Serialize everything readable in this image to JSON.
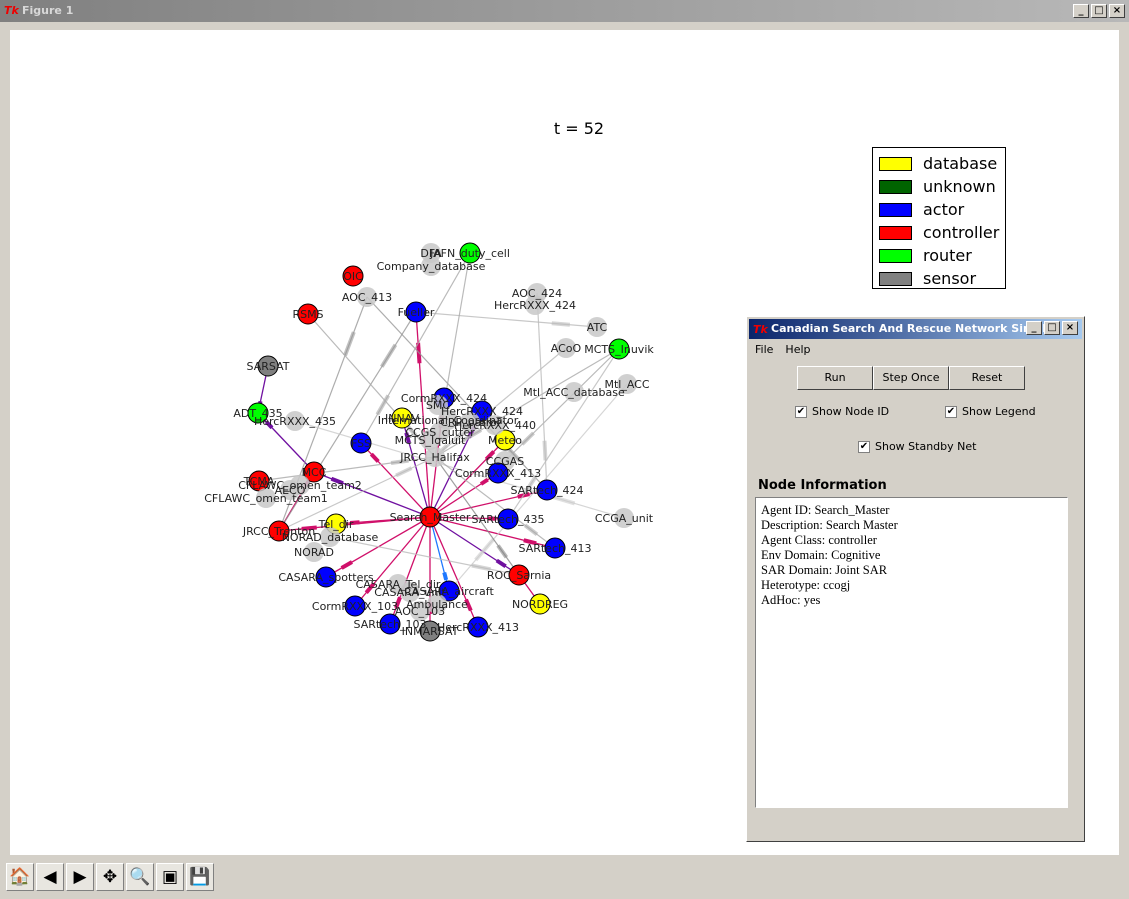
{
  "window": {
    "title": "Figure 1",
    "controls": [
      "_",
      "□",
      "×"
    ]
  },
  "plot": {
    "title": "t = 52",
    "legend": [
      {
        "label": "database",
        "color": "#ffff00"
      },
      {
        "label": "unknown",
        "color": "#006400"
      },
      {
        "label": "actor",
        "color": "#0000ff"
      },
      {
        "label": "controller",
        "color": "#ff0000"
      },
      {
        "label": "router",
        "color": "#00ff00"
      },
      {
        "label": "sensor",
        "color": "#808080"
      }
    ],
    "nodes": [
      {
        "id": "DFA",
        "type": "sensor"
      },
      {
        "id": "JAFN_duty_cell",
        "type": "router"
      },
      {
        "id": "Company_database",
        "type": "sensor"
      },
      {
        "id": "OIC",
        "type": "controller"
      },
      {
        "id": "AOC_413",
        "type": "sensor"
      },
      {
        "id": "RSMS",
        "type": "controller"
      },
      {
        "id": "Fueller",
        "type": "actor"
      },
      {
        "id": "AOC_424",
        "type": "sensor"
      },
      {
        "id": "HercRXXX_424",
        "type": "sensor"
      },
      {
        "id": "ATC",
        "type": "sensor"
      },
      {
        "id": "ACoO",
        "type": "sensor"
      },
      {
        "id": "MCTS_Inuvik",
        "type": "router"
      },
      {
        "id": "Mtl_ACC",
        "type": "sensor"
      },
      {
        "id": "Mtl_ACC_database",
        "type": "sensor"
      },
      {
        "id": "SARSAT",
        "type": "sensor-active"
      },
      {
        "id": "ADT_435",
        "type": "router"
      },
      {
        "id": "HercRXXX_435",
        "type": "sensor"
      },
      {
        "id": "CormRXXX_424",
        "type": "actor"
      },
      {
        "id": "HercRXXX_424",
        "type": "actor"
      },
      {
        "id": "INNAV",
        "type": "database"
      },
      {
        "id": "Meteo",
        "type": "database"
      },
      {
        "id": "FSS",
        "type": "actor"
      },
      {
        "id": "JRCC_Halifax",
        "type": "sensor"
      },
      {
        "id": "CCGAS",
        "type": "sensor"
      },
      {
        "id": "CormRXXX_413",
        "type": "actor"
      },
      {
        "id": "SARtech_424",
        "type": "actor"
      },
      {
        "id": "MCC",
        "type": "controller"
      },
      {
        "id": "TCMA",
        "type": "controller"
      },
      {
        "id": "CFLAWC_omen_team2",
        "type": "sensor"
      },
      {
        "id": "CFLAWC_omen_team1",
        "type": "sensor"
      },
      {
        "id": "AECO",
        "type": "sensor"
      },
      {
        "id": "Search_Master",
        "type": "controller"
      },
      {
        "id": "SARtech_435",
        "type": "actor"
      },
      {
        "id": "CCGA_unit",
        "type": "sensor"
      },
      {
        "id": "JRCC_Trenton",
        "type": "controller"
      },
      {
        "id": "Tel_dir",
        "type": "database"
      },
      {
        "id": "NORAD_database",
        "type": "sensor"
      },
      {
        "id": "NORAD",
        "type": "sensor"
      },
      {
        "id": "SARtech_413",
        "type": "actor"
      },
      {
        "id": "ROC_Sarnia",
        "type": "controller"
      },
      {
        "id": "NORDREG",
        "type": "database"
      },
      {
        "id": "CASARA_spotters",
        "type": "actor"
      },
      {
        "id": "CASARA_Tel_dir",
        "type": "sensor"
      },
      {
        "id": "CASARA_unit",
        "type": "sensor"
      },
      {
        "id": "CASARA_aircraft",
        "type": "actor"
      },
      {
        "id": "Ambulance",
        "type": "sensor"
      },
      {
        "id": "AOC_103",
        "type": "sensor"
      },
      {
        "id": "CormRXXX_103",
        "type": "actor"
      },
      {
        "id": "SARtech_103",
        "type": "actor"
      },
      {
        "id": "INMARSAT",
        "type": "sensor-active"
      },
      {
        "id": "HercRXXX_413",
        "type": "actor"
      },
      {
        "id": "International_Coordinator",
        "type": "sensor"
      },
      {
        "id": "CRP_patrol",
        "type": "sensor"
      },
      {
        "id": "HercRXXX_440",
        "type": "sensor"
      },
      {
        "id": "CCGS_cutter",
        "type": "sensor"
      },
      {
        "id": "SMC",
        "type": "sensor"
      },
      {
        "id": "MCTS_Iqaluit",
        "type": "sensor"
      }
    ],
    "edges": [
      [
        "Search_Master",
        "Fueller",
        "#d0106a"
      ],
      [
        "Search_Master",
        "FSS",
        "#d0106a"
      ],
      [
        "Search_Master",
        "Meteo",
        "#d0106a"
      ],
      [
        "Search_Master",
        "CormRXXX_413",
        "#d0106a"
      ],
      [
        "Search_Master",
        "SARtech_424",
        "#d0106a"
      ],
      [
        "Search_Master",
        "SARtech_435",
        "#d0106a"
      ],
      [
        "Search_Master",
        "SARtech_413",
        "#d0106a"
      ],
      [
        "Search_Master",
        "Tel_dir",
        "#d0106a"
      ],
      [
        "Search_Master",
        "JRCC_Trenton",
        "#d0106a"
      ],
      [
        "Search_Master",
        "CASARA_spotters",
        "#d0106a"
      ],
      [
        "Search_Master",
        "CormRXXX_103",
        "#d0106a"
      ],
      [
        "Search_Master",
        "SARtech_103",
        "#d0106a"
      ],
      [
        "Search_Master",
        "INMARSAT",
        "#d0106a"
      ],
      [
        "Search_Master",
        "HercRXXX_413",
        "#d0106a"
      ],
      [
        "Search_Master",
        "CASARA_aircraft",
        "#1e78ff"
      ],
      [
        "Search_Master",
        "MCC",
        "#7010a0"
      ],
      [
        "Search_Master",
        "ROC_Sarnia",
        "#7010a0"
      ],
      [
        "Search_Master",
        "INNAV",
        "#7010a0"
      ],
      [
        "Search_Master",
        "HercRXXX_424",
        "#7010a0"
      ],
      [
        "Search_Master",
        "CormRXXX_424",
        "#d0106a"
      ],
      [
        "ROC_Sarnia",
        "NORDREG",
        "#d0106a"
      ],
      [
        "MCC",
        "ADT_435",
        "#7010a0"
      ],
      [
        "SARSAT",
        "ADT_435",
        "#7010a0"
      ],
      [
        "JRCC_Trenton",
        "MCC",
        "#d0106a"
      ],
      [
        "JRCC_Trenton",
        "AOC_413",
        "#999999"
      ],
      [
        "JRCC_Trenton",
        "Fueller",
        "#999999"
      ],
      [
        "JRCC_Trenton",
        "JRCC_Halifax",
        "#bbbbbb"
      ],
      [
        "RSMS",
        "JRCC_Halifax",
        "#aaaaaa"
      ],
      [
        "AOC_413",
        "SARtech_424",
        "#999999"
      ],
      [
        "Fueller",
        "ATC",
        "#bbbbbb"
      ],
      [
        "JAFN_duty_cell",
        "JRCC_Halifax",
        "#aaaaaa"
      ],
      [
        "JAFN_duty_cell",
        "FSS",
        "#aaaaaa"
      ],
      [
        "MCTS_Inuvik",
        "JRCC_Halifax",
        "#aaaaaa"
      ],
      [
        "MCTS_Inuvik",
        "CCGAS",
        "#aaaaaa"
      ],
      [
        "MCTS_Inuvik",
        "SARtech_435",
        "#bbbbbb"
      ],
      [
        "ACoO",
        "JRCC_Halifax",
        "#bbbbbb"
      ],
      [
        "HercRXXX_424",
        "JRCC_Halifax",
        "#bbbbbb"
      ],
      [
        "AOC_424",
        "SARtech_424",
        "#bbbbbb"
      ],
      [
        "HercRXXX_435",
        "CCGA_unit",
        "#cccccc"
      ],
      [
        "Mtl_ACC",
        "CASARA_aircraft",
        "#cccccc"
      ],
      [
        "JRCC_Halifax",
        "SARtech_413",
        "#aaaaaa"
      ],
      [
        "JRCC_Halifax",
        "ROC_Sarnia",
        "#888888"
      ],
      [
        "NORAD_database",
        "ROC_Sarnia",
        "#bbbbbb"
      ],
      [
        "TCMA",
        "JRCC_Halifax",
        "#aaaaaa"
      ]
    ]
  },
  "toolbar": [
    {
      "name": "home-icon",
      "glyph": "🏠"
    },
    {
      "name": "back-icon",
      "glyph": "◀"
    },
    {
      "name": "forward-icon",
      "glyph": "▶"
    },
    {
      "name": "pan-icon",
      "glyph": "✥"
    },
    {
      "name": "zoom-rect-icon",
      "glyph": "🔍"
    },
    {
      "name": "subplots-icon",
      "glyph": "▣"
    },
    {
      "name": "save-icon",
      "glyph": "💾"
    }
  ],
  "dialog": {
    "title": "Canadian Search And Rescue Network Simul...",
    "menu": [
      "File",
      "Help"
    ],
    "buttons": [
      "Run",
      "Step Once",
      "Reset"
    ],
    "checkboxes": [
      {
        "label": "Show Node ID",
        "checked": true
      },
      {
        "label": "Show Legend",
        "checked": true
      },
      {
        "label": "Show Standby Net",
        "checked": true
      }
    ],
    "info_title": "Node Information",
    "info_lines": [
      "Agent ID: Search_Master",
      "Description: Search Master",
      "Agent Class: controller",
      "Env Domain: Cognitive",
      "SAR Domain: Joint SAR",
      "Heterotype: ccogj",
      "AdHoc: yes"
    ]
  }
}
